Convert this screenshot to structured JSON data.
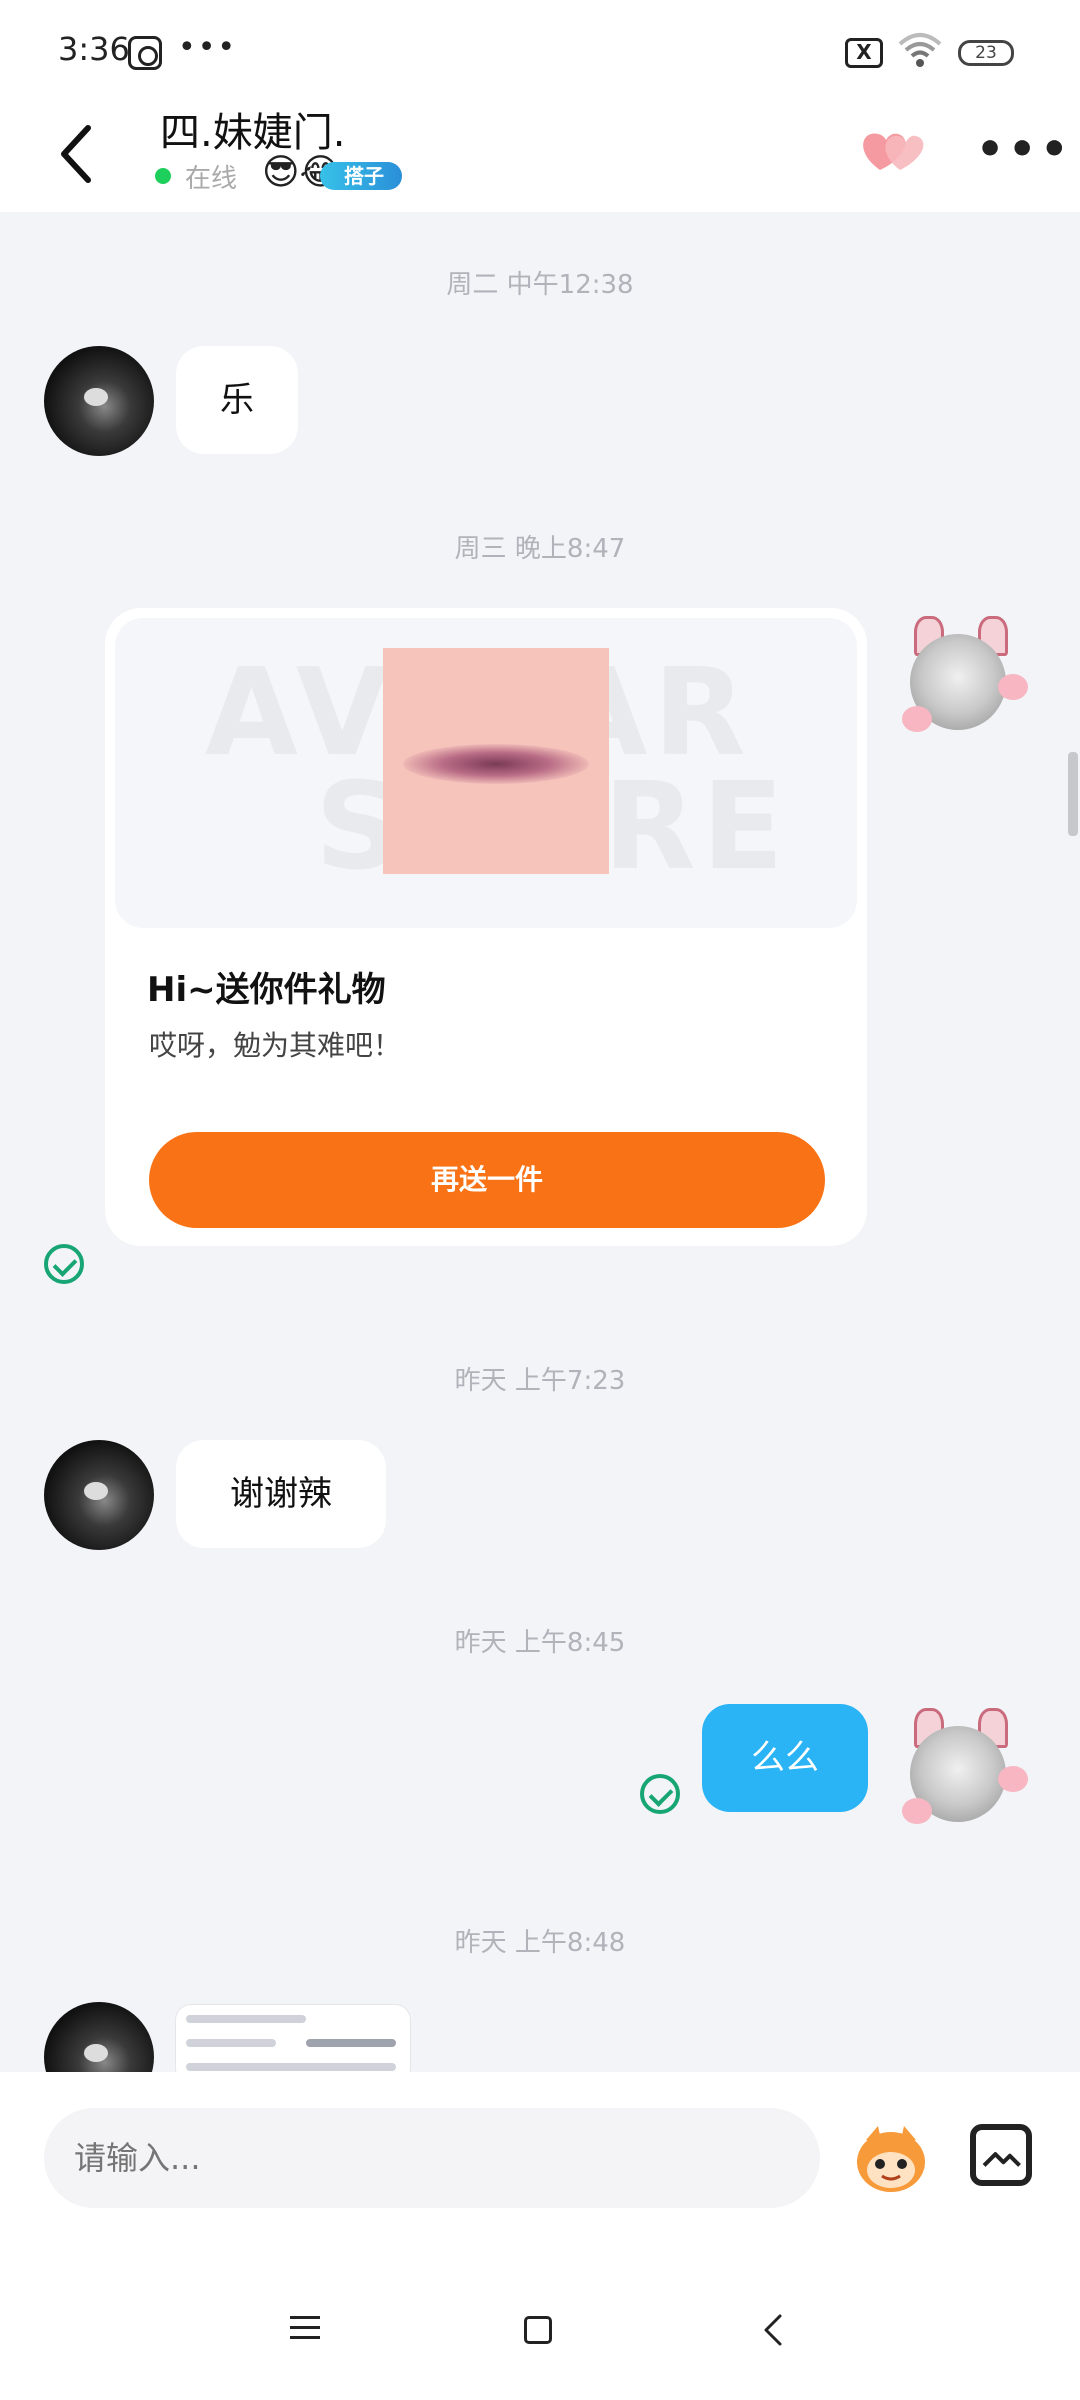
{
  "status_bar": {
    "time": "3:36",
    "more": "•••",
    "sim_label": "X",
    "battery": "23"
  },
  "header": {
    "title": "四.妹婕门.",
    "status": "在线",
    "badge_emoji": "😎😂",
    "tag_label": "搭子",
    "more": "•••"
  },
  "messages": {
    "stamp1": "周二 中午12:38",
    "msg1": "乐",
    "stamp2": "周三 晚上8:47",
    "gift": {
      "watermark_top": "AVATAR",
      "watermark_bottom": "STORE",
      "title": "Hi~送你件礼物",
      "subtitle": "哎呀，勉为其难吧！",
      "button": "再送一件"
    },
    "stamp3": "昨天 上午7:23",
    "msg2": "谢谢辣",
    "stamp4": "昨天 上午8:45",
    "msg3": "么么",
    "stamp5": "昨天 上午8:48"
  },
  "input": {
    "placeholder": "请输入..."
  },
  "colors": {
    "accent_orange": "#f97316",
    "bubble_blue": "#2ab4f5",
    "online_green": "#1fcf5c",
    "check_green": "#17a673"
  },
  "icons": [
    "back-arrow-icon",
    "heart-icon",
    "more-icon",
    "check-icon",
    "mascot-icon",
    "image-icon",
    "menu-icon",
    "home-icon"
  ]
}
